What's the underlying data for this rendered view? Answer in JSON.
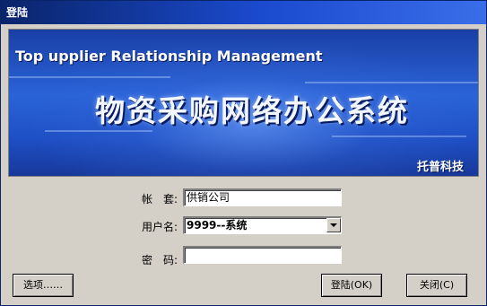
{
  "window": {
    "title": "登陆"
  },
  "banner": {
    "english_title": "Top upplier Relationship Management",
    "chinese_title": "物资采购网络办公系统",
    "company": "托普科技"
  },
  "form": {
    "account_label": "帐　套:",
    "account_value": "供销公司",
    "username_label": "用户名:",
    "username_value": "9999--系统",
    "password_label": "密　码:",
    "password_value": ""
  },
  "buttons": {
    "options": "选项……",
    "login": "登陆(OK)",
    "close": "关闭(C)"
  },
  "colors": {
    "titlebar": "#0a246a",
    "banner": "#2a63d8",
    "window_bg": "#d4d0c8"
  }
}
